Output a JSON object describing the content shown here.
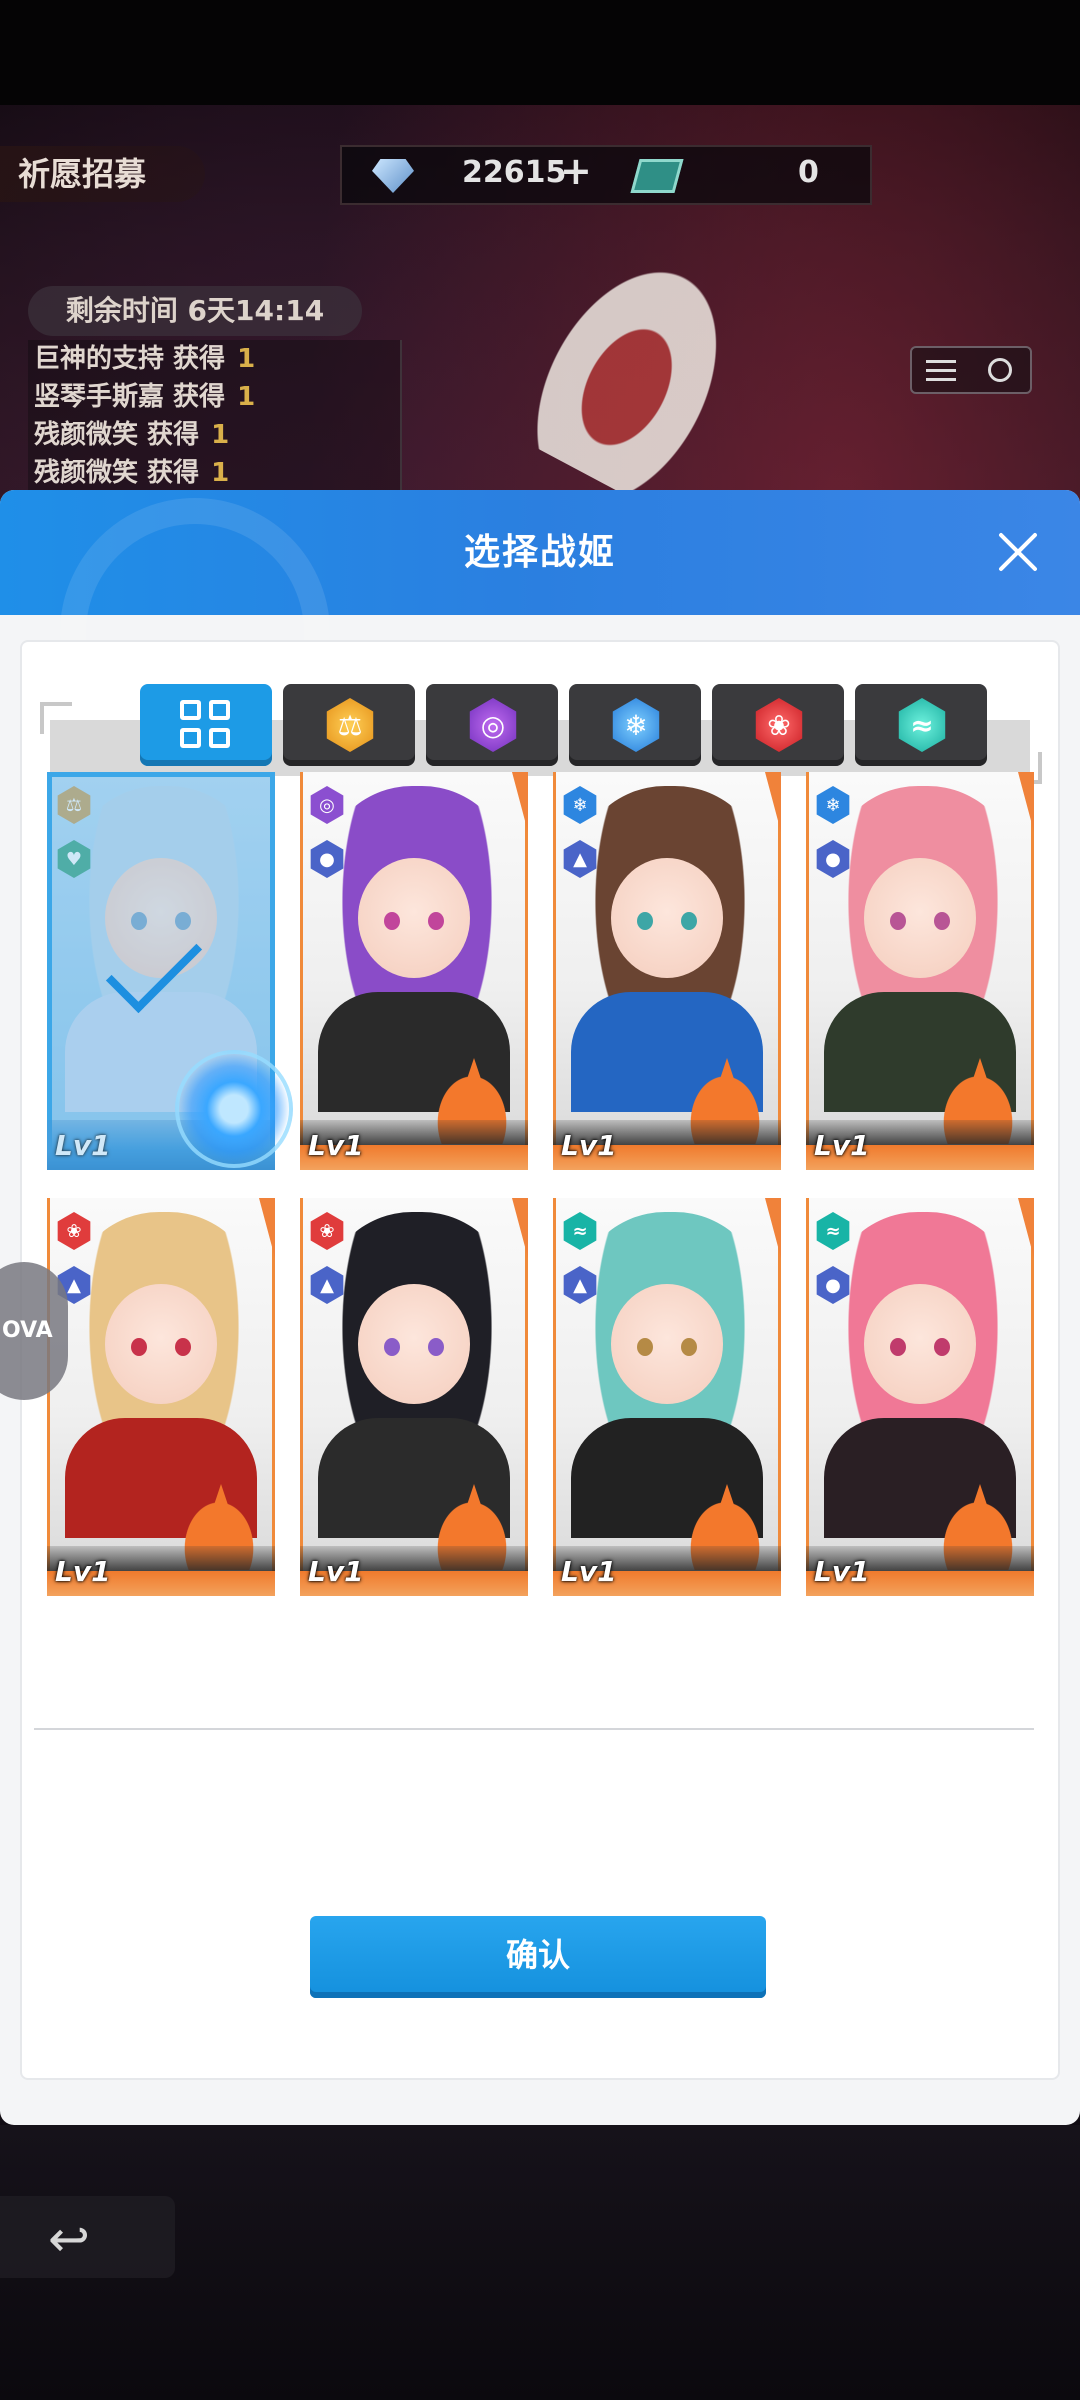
{
  "background": {
    "screen_title": "祈愿招募",
    "currency": {
      "gems": "22615",
      "tickets": "0"
    },
    "time_left": "剩余时间 6天14:14",
    "ticker": [
      {
        "text": "巨神的支持 获得",
        "count": "1"
      },
      {
        "text": "竖琴手斯嘉 获得",
        "count": "1"
      },
      {
        "text": "残颜微笑 获得",
        "count": "1"
      },
      {
        "text": "残颜微笑 获得",
        "count": "1"
      }
    ],
    "float_label": "OVA"
  },
  "modal": {
    "title": "选择战姬",
    "confirm_label": "确认",
    "filters": [
      {
        "name": "all",
        "icon": "grid-icon",
        "active": true
      },
      {
        "name": "gold",
        "icon": "scales-icon",
        "color": "#e28a12"
      },
      {
        "name": "purple",
        "icon": "vortex-icon",
        "color": "#6a2ab8"
      },
      {
        "name": "ice",
        "icon": "snowflake-icon",
        "color": "#1d74d6"
      },
      {
        "name": "fire",
        "icon": "flame-icon",
        "color": "#c4151c"
      },
      {
        "name": "water",
        "icon": "wave-icon",
        "color": "#12a89a"
      }
    ],
    "cards": [
      {
        "level": "Lv1",
        "selected": true,
        "hair": "#bcd8ec",
        "outfit": "#c5d9f0",
        "eyes": "#7aa5c8",
        "element": "gold",
        "class": "heart"
      },
      {
        "level": "Lv1",
        "selected": false,
        "hair": "#8a4cc8",
        "outfit": "#2a2a2a",
        "eyes": "#c1459b",
        "element": "purple",
        "class": "person"
      },
      {
        "level": "Lv1",
        "selected": false,
        "hair": "#6a4432",
        "outfit": "#2466c2",
        "eyes": "#3da6a6",
        "element": "ice",
        "class": "hat"
      },
      {
        "level": "Lv1",
        "selected": false,
        "hair": "#ef8ea0",
        "outfit": "#2f3b2c",
        "eyes": "#b85595",
        "element": "ice",
        "class": "person"
      },
      {
        "level": "Lv1",
        "selected": false,
        "hair": "#e8c488",
        "outfit": "#b3241f",
        "eyes": "#c8324a",
        "element": "fire",
        "class": "hat"
      },
      {
        "level": "Lv1",
        "selected": false,
        "hair": "#1f1f26",
        "outfit": "#2b2b2b",
        "eyes": "#8a5cc8",
        "element": "fire",
        "class": "hat"
      },
      {
        "level": "Lv1",
        "selected": false,
        "hair": "#6ec7c0",
        "outfit": "#222222",
        "eyes": "#b58a45",
        "element": "water",
        "class": "hat"
      },
      {
        "level": "Lv1",
        "selected": false,
        "hair": "#f07896",
        "outfit": "#2a1f24",
        "eyes": "#c03b6c",
        "element": "water",
        "class": "person"
      }
    ]
  }
}
